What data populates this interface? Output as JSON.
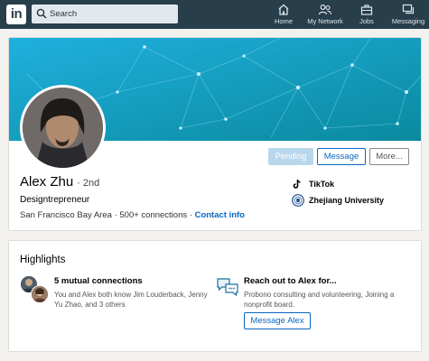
{
  "nav": {
    "logo": "in",
    "search_placeholder": "Search",
    "items": [
      {
        "label": "Home",
        "icon": "home-icon"
      },
      {
        "label": "My Network",
        "icon": "my-network-icon"
      },
      {
        "label": "Jobs",
        "icon": "jobs-icon"
      },
      {
        "label": "Messaging",
        "icon": "messaging-icon"
      }
    ]
  },
  "profile": {
    "name": "Alex Zhu",
    "degree": "· 2nd",
    "headline": "Designtrepreneur",
    "location": "San Francisco Bay Area",
    "connections": "500+ connections",
    "contact_info": "Contact info",
    "buttons": {
      "pending": "Pending",
      "message": "Message",
      "more": "More..."
    },
    "orgs": [
      {
        "name": "TikTok",
        "icon": "tiktok-icon"
      },
      {
        "name": "Zhejiang University",
        "icon": "university-icon"
      }
    ]
  },
  "highlights": {
    "title": "Highlights",
    "mutual": {
      "heading": "5 mutual connections",
      "text": "You and Alex both know Jim Louderback, Jenny Yu Zhao, and 3 others"
    },
    "reach_out": {
      "heading": "Reach out to Alex for...",
      "text": "Probono consulting and volunteering, Joining a nonprofit board.",
      "button": "Message Alex"
    }
  },
  "colors": {
    "nav_bg": "#283e4a",
    "accent": "#0a66c2",
    "banner_start": "#1aa9d6",
    "banner_end": "#0a8a9e"
  }
}
